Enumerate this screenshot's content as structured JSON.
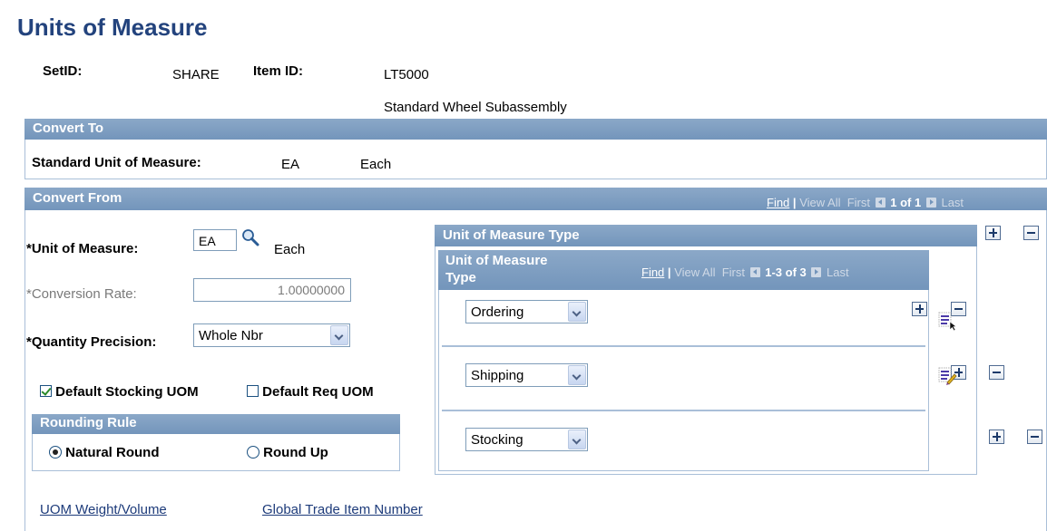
{
  "page": {
    "title": "Units of Measure"
  },
  "header": {
    "setid_label": "SetID:",
    "setid_value": "SHARE",
    "itemid_label": "Item ID:",
    "itemid_value": "LT5000",
    "item_description": "Standard Wheel Subassembly"
  },
  "convert_to": {
    "header": "Convert To",
    "std_uom_label": "Standard Unit of Measure:",
    "std_uom_code": "EA",
    "std_uom_desc": "Each"
  },
  "convert_from": {
    "header": "Convert From",
    "nav": {
      "find": "Find",
      "sep": "|",
      "view_all": "View All",
      "first": "First",
      "count": "1 of 1",
      "last": "Last"
    },
    "uom_label": "*Unit of Measure:",
    "uom_value": "EA",
    "uom_desc": "Each",
    "conversion_label": "*Conversion Rate:",
    "conversion_value": "1.00000000",
    "precision_label": "*Quantity Precision:",
    "precision_value": "Whole Nbr",
    "default_stocking_label": "Default Stocking UOM",
    "default_stocking_checked": true,
    "default_req_label": "Default Req UOM",
    "default_req_checked": false,
    "rounding": {
      "header": "Rounding Rule",
      "natural_label": "Natural Round",
      "round_up_label": "Round Up",
      "selected": "Natural Round"
    }
  },
  "uom_type": {
    "header": "Unit of Measure Type",
    "grid_header_line1": "Unit of Measure",
    "grid_header_line2": "Type",
    "nav": {
      "find": "Find",
      "sep": "|",
      "view_all": "View All",
      "first": "First",
      "count": "1-3 of 3",
      "last": "Last"
    },
    "rows": [
      {
        "value": "Ordering",
        "icon": "detail-select-icon"
      },
      {
        "value": "Shipping",
        "icon": "edit-list-icon"
      },
      {
        "value": "Stocking",
        "icon": ""
      }
    ]
  },
  "footer_links": {
    "weight_volume": "UOM Weight/Volume",
    "gtin": "Global Trade Item Number"
  },
  "colors": {
    "title": "#23437d",
    "section_header": "#7f9dbf",
    "panel_border": "#a9bfd8",
    "link": "#1d3b7a"
  }
}
